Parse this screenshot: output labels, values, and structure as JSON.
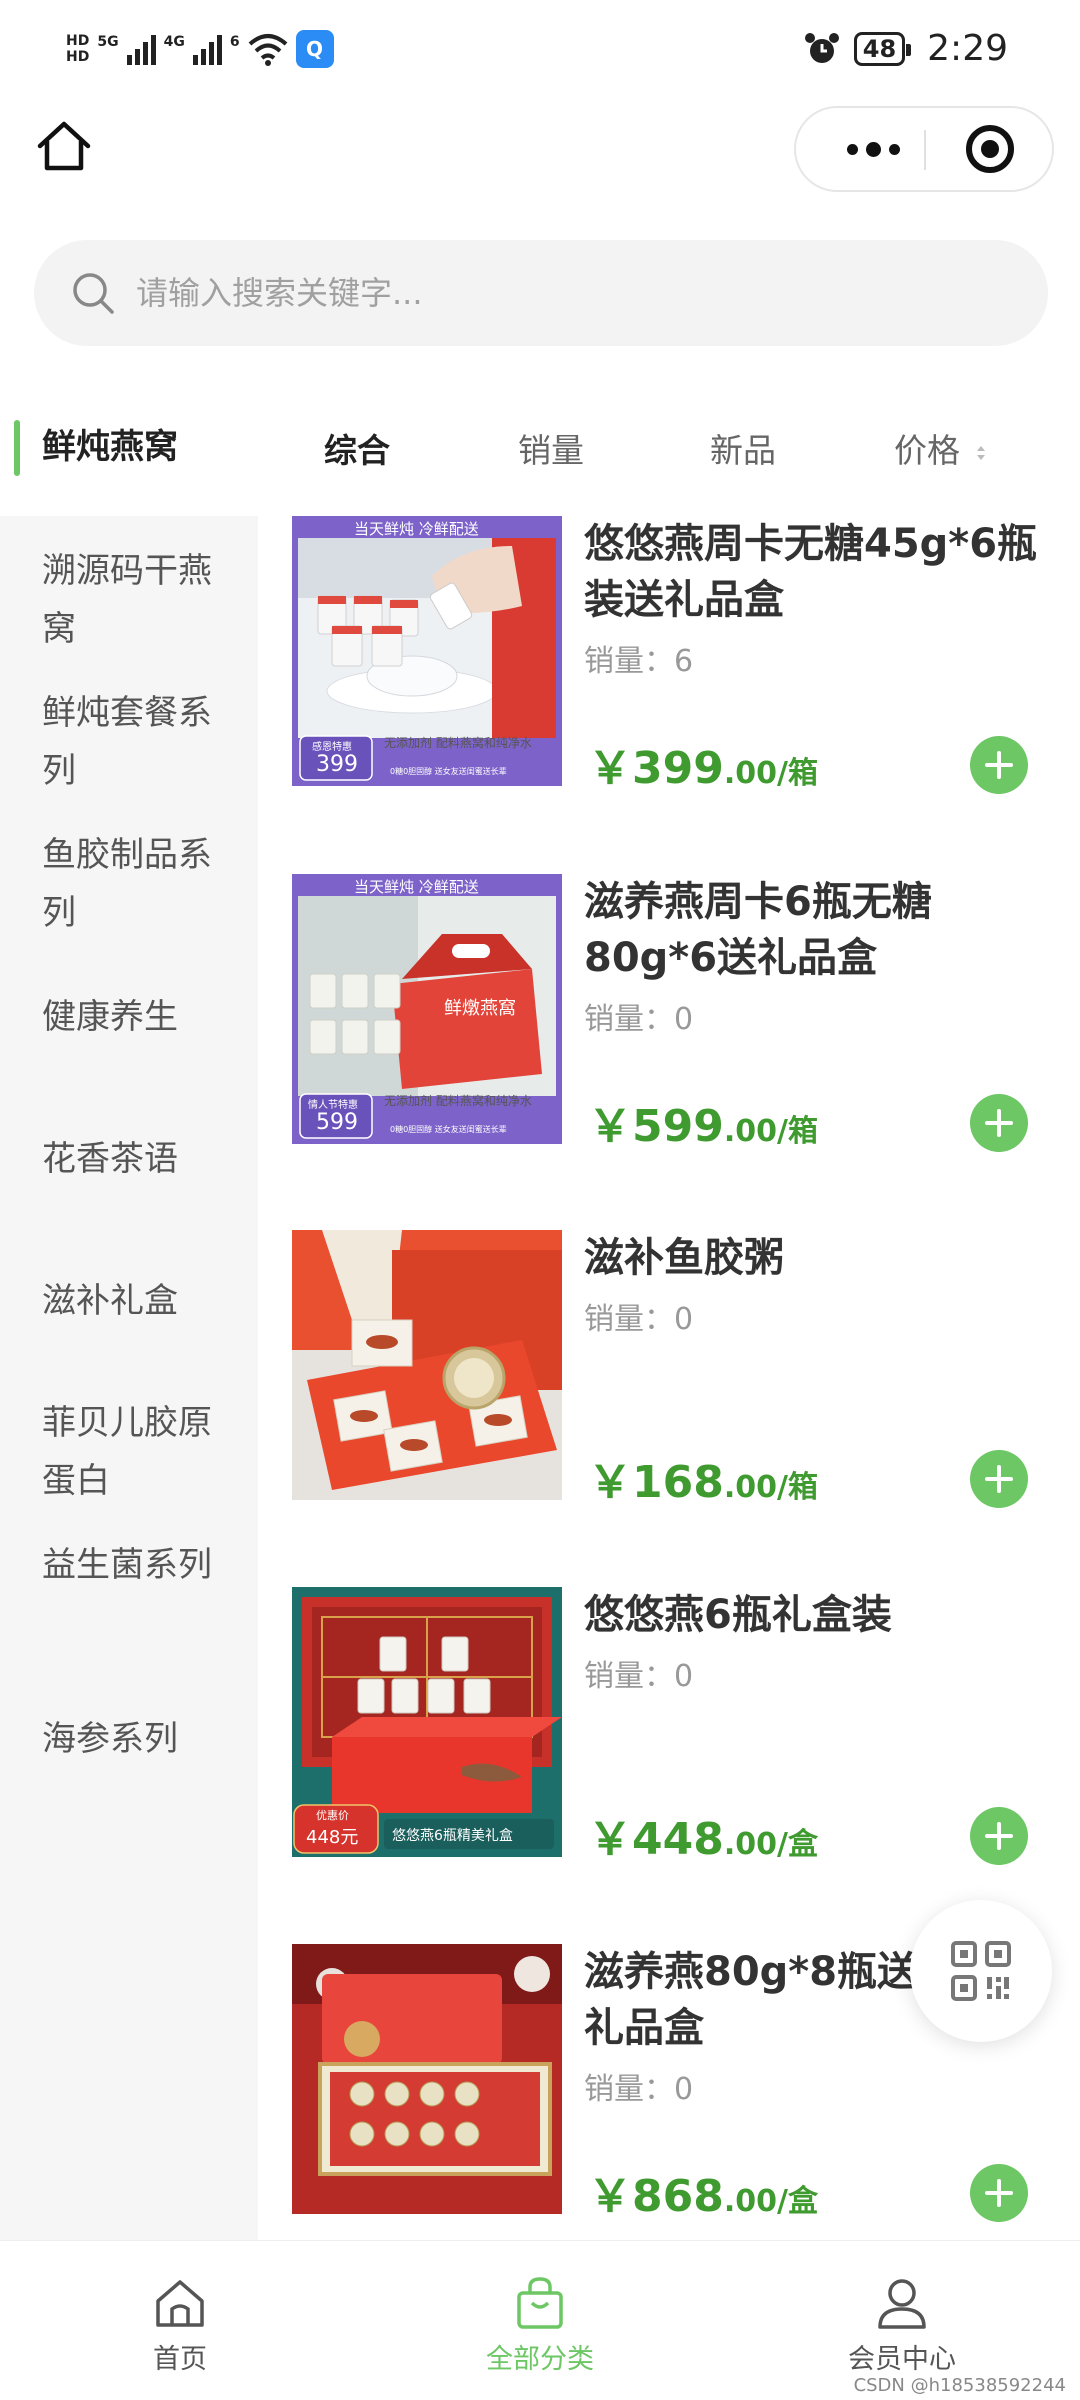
{
  "status_bar": {
    "net_top": "HD",
    "net_bottom": "HD",
    "gen1": "5G",
    "gen2": "4G",
    "wifi_gen": "6",
    "battery": "48",
    "time": "2:29"
  },
  "search": {
    "placeholder": "请输入搜索关键字..."
  },
  "sidebar": {
    "items": [
      {
        "label": "鲜炖燕窝",
        "active": true
      },
      {
        "label": "溯源码干燕窝"
      },
      {
        "label": "鲜炖套餐系列"
      },
      {
        "label": "鱼胶制品系列"
      },
      {
        "label": "健康养生"
      },
      {
        "label": "花香茶语"
      },
      {
        "label": "滋补礼盒"
      },
      {
        "label": "菲贝儿胶原蛋白"
      },
      {
        "label": "益生菌系列"
      },
      {
        "label": "海参系列"
      }
    ]
  },
  "sort_tabs": [
    "综合",
    "销量",
    "新品",
    "价格"
  ],
  "sales_label": "销量：",
  "currency": "￥",
  "products": [
    {
      "name": "悠悠燕周卡无糖45g*6瓶装送礼品盒",
      "sales": "6",
      "price_int": "399",
      "price_dec": ".00",
      "unit": "/箱",
      "banner_top": "当天鲜炖 冷鲜配送",
      "badge_label": "感恩特惠",
      "badge_price": "399",
      "side_text": "无添加剂 配料燕窝和纯净水",
      "foot_text": "0糖0胆固醇 送女友送闺蜜送长辈"
    },
    {
      "name": "滋养燕周卡6瓶无糖80g*6送礼品盒",
      "sales": "0",
      "price_int": "599",
      "price_dec": ".00",
      "unit": "/箱",
      "banner_top": "当天鲜炖 冷鲜配送",
      "badge_label": "情人节特惠",
      "badge_price": "599",
      "side_text": "无添加剂 配料燕窝和纯净水",
      "foot_text": "0糖0胆固醇 送女友送闺蜜送长辈",
      "box_text": "鲜燉燕窩"
    },
    {
      "name": "滋补鱼胶粥",
      "sales": "0",
      "price_int": "168",
      "price_dec": ".00",
      "unit": "/箱"
    },
    {
      "name": "悠悠燕6瓶礼盒装",
      "sales": "0",
      "price_int": "448",
      "price_dec": ".00",
      "unit": "/盒",
      "badge_label": "优惠价",
      "badge_price": "448元",
      "foot_text": "悠悠燕6瓶精美礼盒"
    },
    {
      "name": "滋养燕80g*8瓶送礼品送礼品盒",
      "sales": "0",
      "price_int": "868",
      "price_dec": ".00",
      "unit": "/盒"
    }
  ],
  "tabbar": [
    {
      "label": "首页"
    },
    {
      "label": "全部分类",
      "active": true
    },
    {
      "label": "会员中心"
    }
  ],
  "watermark": "CSDN @h18538592244",
  "colors": {
    "accent": "#6cc764",
    "price": "#3f9a2f",
    "sidebar_bg": "#f6f6f6"
  }
}
